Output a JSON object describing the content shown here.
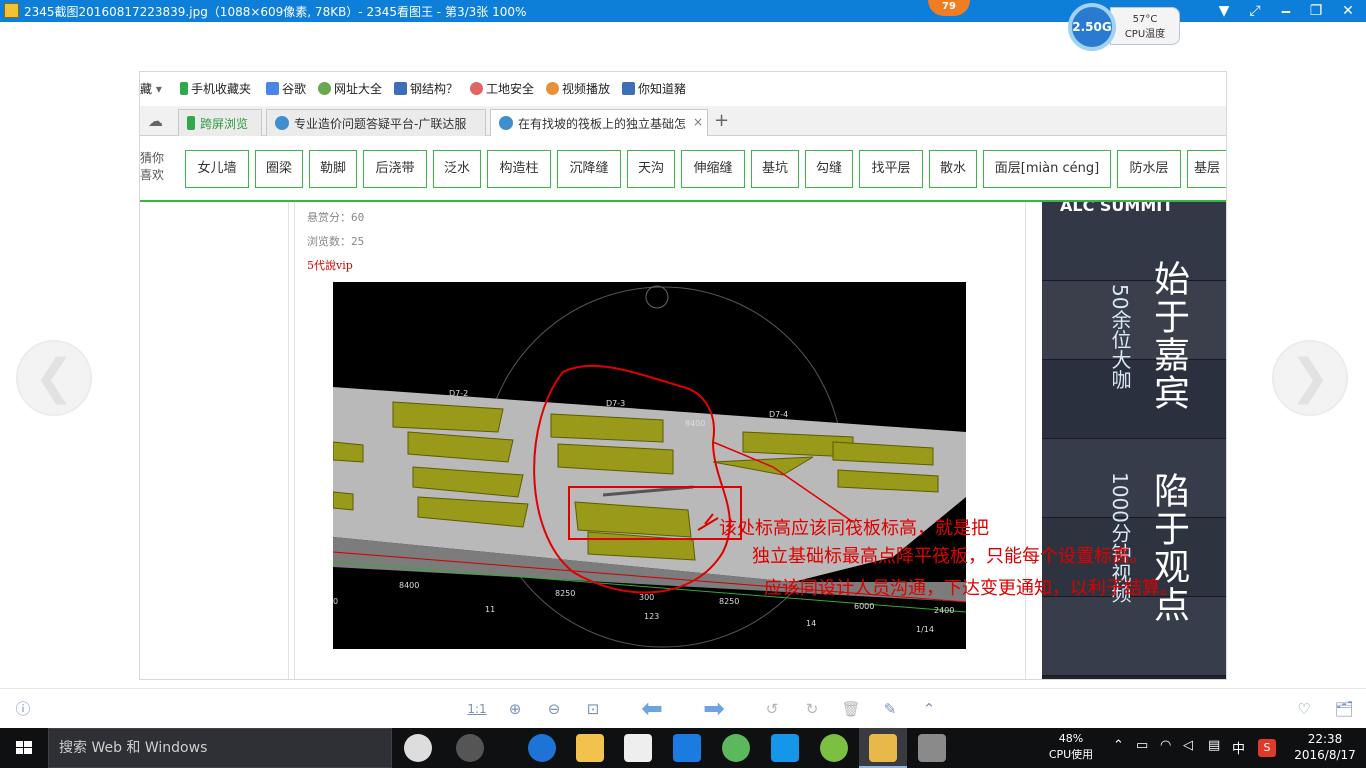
{
  "window": {
    "title": "2345截图20160817223839.jpg（1088×609像素, 78KB）- 2345看图王 - 第3/3张 100%",
    "badge": "79",
    "buttons": [
      "▼",
      "⤢",
      "🗕",
      "❐",
      "✕"
    ]
  },
  "cpu_widget": {
    "freq": "2.50G",
    "temp": "57°C",
    "label": "CPU温度"
  },
  "browser": {
    "bookmarks": [
      {
        "label": "藏",
        "icon": "chevron-down-icon"
      },
      {
        "label": "手机收藏夹",
        "icon": "phone-icon"
      },
      {
        "label": "谷歌",
        "icon": "google-icon"
      },
      {
        "label": "网址大全",
        "icon": "site-nav-icon"
      },
      {
        "label": "钢结构？",
        "icon": "site-icon"
      },
      {
        "label": "工地安全",
        "icon": "site-icon"
      },
      {
        "label": "视频播放",
        "icon": "video-icon"
      },
      {
        "label": "你知道豬",
        "icon": "site-icon"
      }
    ],
    "tabs": [
      {
        "label": "跨屏浏览",
        "active": false
      },
      {
        "label": "专业造价问题答疑平台-广联达服",
        "active": false
      },
      {
        "label": "在有找坡的筏板上的独立基础怎",
        "active": true
      }
    ],
    "new_tab": "+",
    "tags_lead": [
      "猜你",
      "喜欢"
    ],
    "tags": [
      "女儿墙",
      "圈梁",
      "勒脚",
      "后浇带",
      "泛水",
      "构造柱",
      "沉降缝",
      "天沟",
      "伸缩缝",
      "基坑",
      "勾缝",
      "找平层",
      "散水",
      "面层[miàn céng]",
      "防水层",
      "基层"
    ]
  },
  "question": {
    "reward": "悬赏分：60",
    "views": "浏览数：25",
    "user": "5代說vip"
  },
  "cad": {
    "labels": [
      "D7-2",
      "D7-3",
      "D7-4",
      "8400",
      "8250",
      "8250",
      "6000",
      "2400",
      "11",
      "123",
      "14",
      "1/14",
      "300",
      "0",
      "8400"
    ]
  },
  "ad": {
    "top": "ALC SUMMIT",
    "line1": "始于嘉宾",
    "line1_sub": "50余位大咖",
    "line2": "陷于观点",
    "line2_sub": "1000分钟视频"
  },
  "annotations": [
    "该处标高应该同筏板标高，就是把",
    "独立基础标最高点降平筏板，只能每个设置标高。",
    "应该同设计人员沟通，下达变更通知，以利于结算。"
  ],
  "toolbar": {
    "info": "ⓘ",
    "ratio": "1:1",
    "zoom_in": "⊕",
    "zoom_out": "⊖",
    "fit": "⊡",
    "prev": "⬅",
    "next": "➡",
    "rot_left": "↺",
    "rot_right": "↻",
    "delete": "🗑",
    "edit": "✎",
    "up": "⌃",
    "fav": "♡",
    "folder": "🗂"
  },
  "taskbar": {
    "search_placeholder": "搜索 Web 和 Windows",
    "cpu_percent": "48%",
    "cpu_label": "CPU使用",
    "ime": "中",
    "time": "22:38",
    "date": "2016/8/17"
  }
}
